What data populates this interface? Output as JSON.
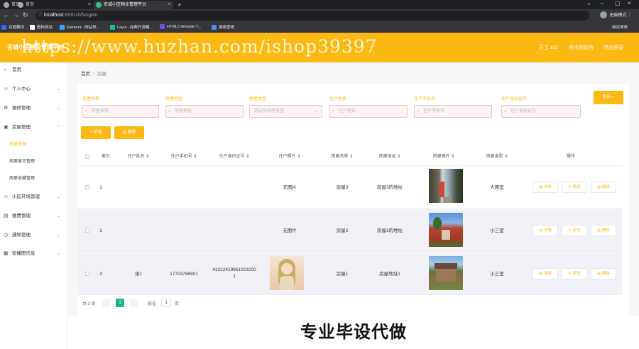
{
  "browser": {
    "tabs": [
      {
        "title": "首页"
      },
      {
        "title": "首页"
      },
      {
        "title": "名城小区物业管理平台"
      }
    ],
    "new_tab": "+",
    "url_host": "localhost",
    "url_path": ":8081/#/fangwu",
    "profile_label": "无痕模式",
    "bookmarks": [
      {
        "label": "百度翻译",
        "color": "#2f6bff"
      },
      {
        "label": "图标网站",
        "color": "#ffffff"
      },
      {
        "label": "Element - 网站快...",
        "color": "#409eff"
      },
      {
        "label": "Layui - 经典开源模...",
        "color": "#16baaa"
      },
      {
        "label": "HTML5 Website T...",
        "color": "#7b4ae2"
      },
      {
        "label": "搜索壁纸",
        "color": "#4b8bf5"
      }
    ],
    "bookmarks_right": "阅读清单"
  },
  "header": {
    "title": "名城小区物业管理平台",
    "watermark": "https://www.huzhan.com/ishop39397",
    "user_label": "员工 a11",
    "back_label": "退出到前台",
    "logout_label": "退出登录"
  },
  "sidebar": {
    "items": [
      {
        "label": "首页",
        "icon": "⌂"
      },
      {
        "label": "个人中心",
        "icon": "☺"
      },
      {
        "label": "报修管理",
        "icon": "⚙"
      },
      {
        "label": "房屋管理",
        "icon": "▣"
      },
      {
        "label": "小区环境管理",
        "icon": "☺"
      },
      {
        "label": "缴费管理",
        "icon": "▤"
      },
      {
        "label": "通知管理",
        "icon": "◷"
      },
      {
        "label": "轮播图信息",
        "icon": "▦"
      }
    ],
    "sub_items": [
      {
        "label": "房屋管理"
      },
      {
        "label": "房屋留言管理"
      },
      {
        "label": "房屋收藏管理"
      }
    ]
  },
  "breadcrumb": {
    "home": "首页",
    "sep": "/",
    "current": "房屋"
  },
  "filters": [
    {
      "label": "房屋名称",
      "placeholder": "房屋名称"
    },
    {
      "label": "房屋地址",
      "placeholder": "房屋地址"
    },
    {
      "label": "房屋类型",
      "placeholder": "请选择房屋类型"
    },
    {
      "label": "住户姓名",
      "placeholder": "住户姓名"
    },
    {
      "label": "住户手机号",
      "placeholder": "住户手机号"
    },
    {
      "label": "住户身份证号",
      "placeholder": "住户身份证号"
    }
  ],
  "buttons": {
    "search": "查询",
    "add": "新增",
    "delete": "删除"
  },
  "table": {
    "headers": [
      "索引",
      "住户姓名",
      "住户手机号",
      "住户身份证号",
      "住户照片",
      "房屋名称",
      "房屋地址",
      "房屋图片",
      "房屋类型",
      "操作"
    ],
    "no_photo": "无图片",
    "op_detail": "详情",
    "op_edit": "修改",
    "op_delete": "删除",
    "rows": [
      {
        "index": "1",
        "name": "",
        "phone": "",
        "idcard": "",
        "photo": "",
        "house_name": "房屋3",
        "address": "房屋3的地址",
        "house_type": "大两室"
      },
      {
        "index": "2",
        "name": "",
        "phone": "",
        "idcard": "",
        "photo": "",
        "house_name": "房屋2",
        "address": "房屋2的地址",
        "house_type": "小三室"
      },
      {
        "index": "3",
        "name": "张1",
        "phone": "17703786901",
        "idcard": "410224199610232001",
        "photo": "has",
        "house_name": "房屋1",
        "address": "房屋地址1",
        "house_type": "小三室"
      }
    ]
  },
  "pager": {
    "total": "共 3 条",
    "prev": "‹",
    "page": "1",
    "next": "›",
    "goto": "前往",
    "goto_value": "1",
    "unit": "页"
  },
  "banner": {
    "text": "专业毕设代做"
  }
}
